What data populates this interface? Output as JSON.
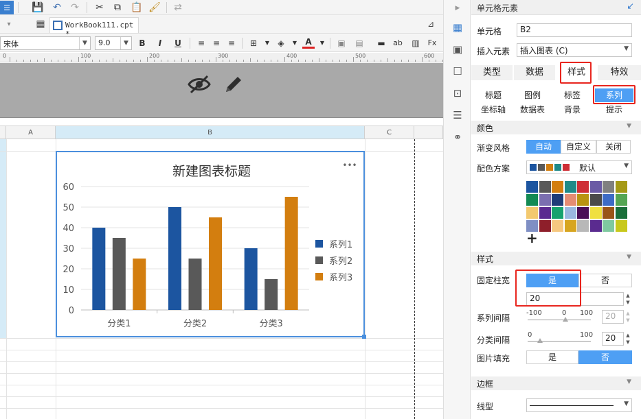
{
  "toolbar": {
    "file_tab": "WorkBook111.cpt *",
    "font_name": "宋体",
    "font_size": "9.0",
    "bold": "B",
    "italic": "I",
    "underline": "U",
    "ab": "ab"
  },
  "ruler": [
    "0",
    "100",
    "200",
    "300",
    "400",
    "500",
    "600"
  ],
  "grid": {
    "columns": [
      "A",
      "B",
      "C"
    ]
  },
  "chart_data": {
    "type": "bar",
    "title": "新建图表标题",
    "categories": [
      "分类1",
      "分类2",
      "分类3"
    ],
    "series": [
      {
        "name": "系列1",
        "color": "#1c55a0",
        "values": [
          40,
          50,
          30
        ]
      },
      {
        "name": "系列2",
        "color": "#595959",
        "values": [
          35,
          25,
          15
        ]
      },
      {
        "name": "系列3",
        "color": "#d37e0f",
        "values": [
          25,
          45,
          55
        ]
      }
    ],
    "yticks": [
      "0",
      "10",
      "20",
      "30",
      "40",
      "50",
      "60"
    ],
    "ylim": [
      0,
      60
    ],
    "grid": true,
    "legend": "right",
    "menu": "•••"
  },
  "panel": {
    "title": "单元格元素",
    "cell_label": "单元格",
    "cell_value": "B2",
    "insert_label": "插入元素",
    "insert_value": "插入图表 (C)",
    "tabs": [
      "类型",
      "数据",
      "样式",
      "特效"
    ],
    "subtabs_row1": [
      "标题",
      "图例",
      "标签",
      "系列"
    ],
    "subtabs_row2": [
      "坐标轴",
      "数据表",
      "背景",
      "提示"
    ],
    "color_section": "颜色",
    "gradient_label": "渐变风格",
    "gradient_options": [
      "自动",
      "自定义",
      "关闭"
    ],
    "scheme_label": "配色方案",
    "scheme_value": "默认",
    "style_section": "样式",
    "fixed_width_label": "固定柱宽",
    "fixed_width_options": [
      "是",
      "否"
    ],
    "bar_width_value": "20",
    "series_gap_label": "系列间隔",
    "series_gap_min": "-100",
    "series_gap_mid": "0",
    "series_gap_max": "100",
    "series_gap_value": "20",
    "category_gap_label": "分类间隔",
    "category_gap_min": "0",
    "category_gap_max": "100",
    "category_gap_value": "20",
    "image_fill_label": "图片填充",
    "image_fill_options": [
      "是",
      "否"
    ],
    "border_section": "边框",
    "line_type_label": "线型",
    "add_symbol": "+"
  },
  "palette": [
    [
      "#1c55a0",
      "#595959",
      "#d37e0f",
      "#1f8a88",
      "#ce2f36",
      "#6a5aa5",
      "#808080",
      "#a59a16"
    ],
    [
      "#138a54",
      "#7b6fb0",
      "#1e3c78",
      "#e58c73",
      "#b99411",
      "#4a4a4a",
      "#3d6bc6",
      "#55a654"
    ],
    [
      "#f3c96f",
      "#5b2a90",
      "#16a26e",
      "#9ab8e0",
      "#4a0e56",
      "#f0e040",
      "#9a5417",
      "#1a6f3a"
    ],
    [
      "#7f8fc4",
      "#8e1f2a",
      "#f6c880",
      "#d7a51f",
      "#b8b8b8",
      "#5a2b8f",
      "#7fc9a0",
      "#c8c81c"
    ]
  ]
}
